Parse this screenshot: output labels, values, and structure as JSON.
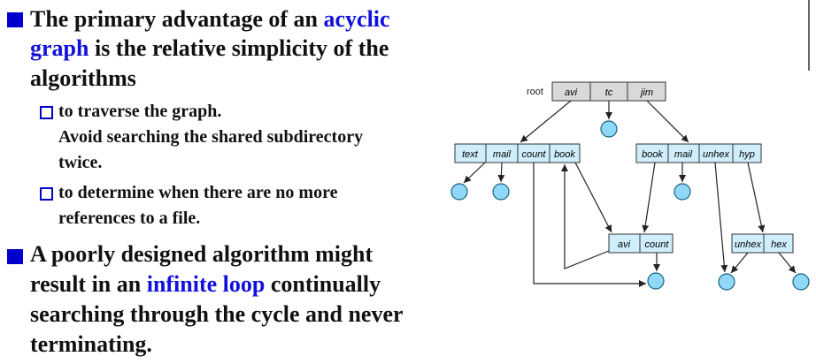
{
  "bullets": [
    {
      "lines": [
        {
          "parts": [
            {
              "text": "The primary advantage of an ",
              "highlight": false
            },
            {
              "text": "acyclic",
              "highlight": true
            }
          ]
        },
        {
          "parts": [
            {
              "text": "graph",
              "highlight": true
            },
            {
              "text": " is the relative simplicity of the",
              "highlight": false
            }
          ]
        },
        {
          "parts": [
            {
              "text": "algorithms",
              "highlight": false
            }
          ]
        }
      ],
      "sub": [
        {
          "lines": [
            "to traverse the graph.",
            "Avoid searching the shared subdirectory",
            "twice."
          ]
        },
        {
          "lines": [
            "to determine when there are no more",
            "references to a file."
          ]
        }
      ]
    },
    {
      "lines": [
        {
          "parts": [
            {
              "text": "A poorly designed algorithm might",
              "highlight": false
            }
          ]
        },
        {
          "parts": [
            {
              "text": "result in an ",
              "highlight": false
            },
            {
              "text": "infinite loop",
              "highlight": true
            },
            {
              "text": " continually",
              "highlight": false
            }
          ]
        },
        {
          "parts": [
            {
              "text": "searching through the cycle and never",
              "highlight": false
            }
          ]
        },
        {
          "parts": [
            {
              "text": "terminating.",
              "highlight": false
            }
          ]
        }
      ]
    }
  ],
  "diagram": {
    "root_label": "root",
    "root_entries": [
      "avi",
      "tc",
      "jim"
    ],
    "dir_tc": [
      "text",
      "mail",
      "count",
      "book"
    ],
    "dir_jim": [
      "book",
      "mail",
      "unhex",
      "hyp"
    ],
    "dir_shared": [
      "avi",
      "count"
    ],
    "dir_hyp": [
      "unhex",
      "hex"
    ],
    "colors": {
      "root_fill": "#d9d9d9",
      "dir_fill": "#cfeefc",
      "file_fill": "#8fd8f8",
      "bullet": "#0000cc",
      "highlight": "#1111dd"
    }
  }
}
